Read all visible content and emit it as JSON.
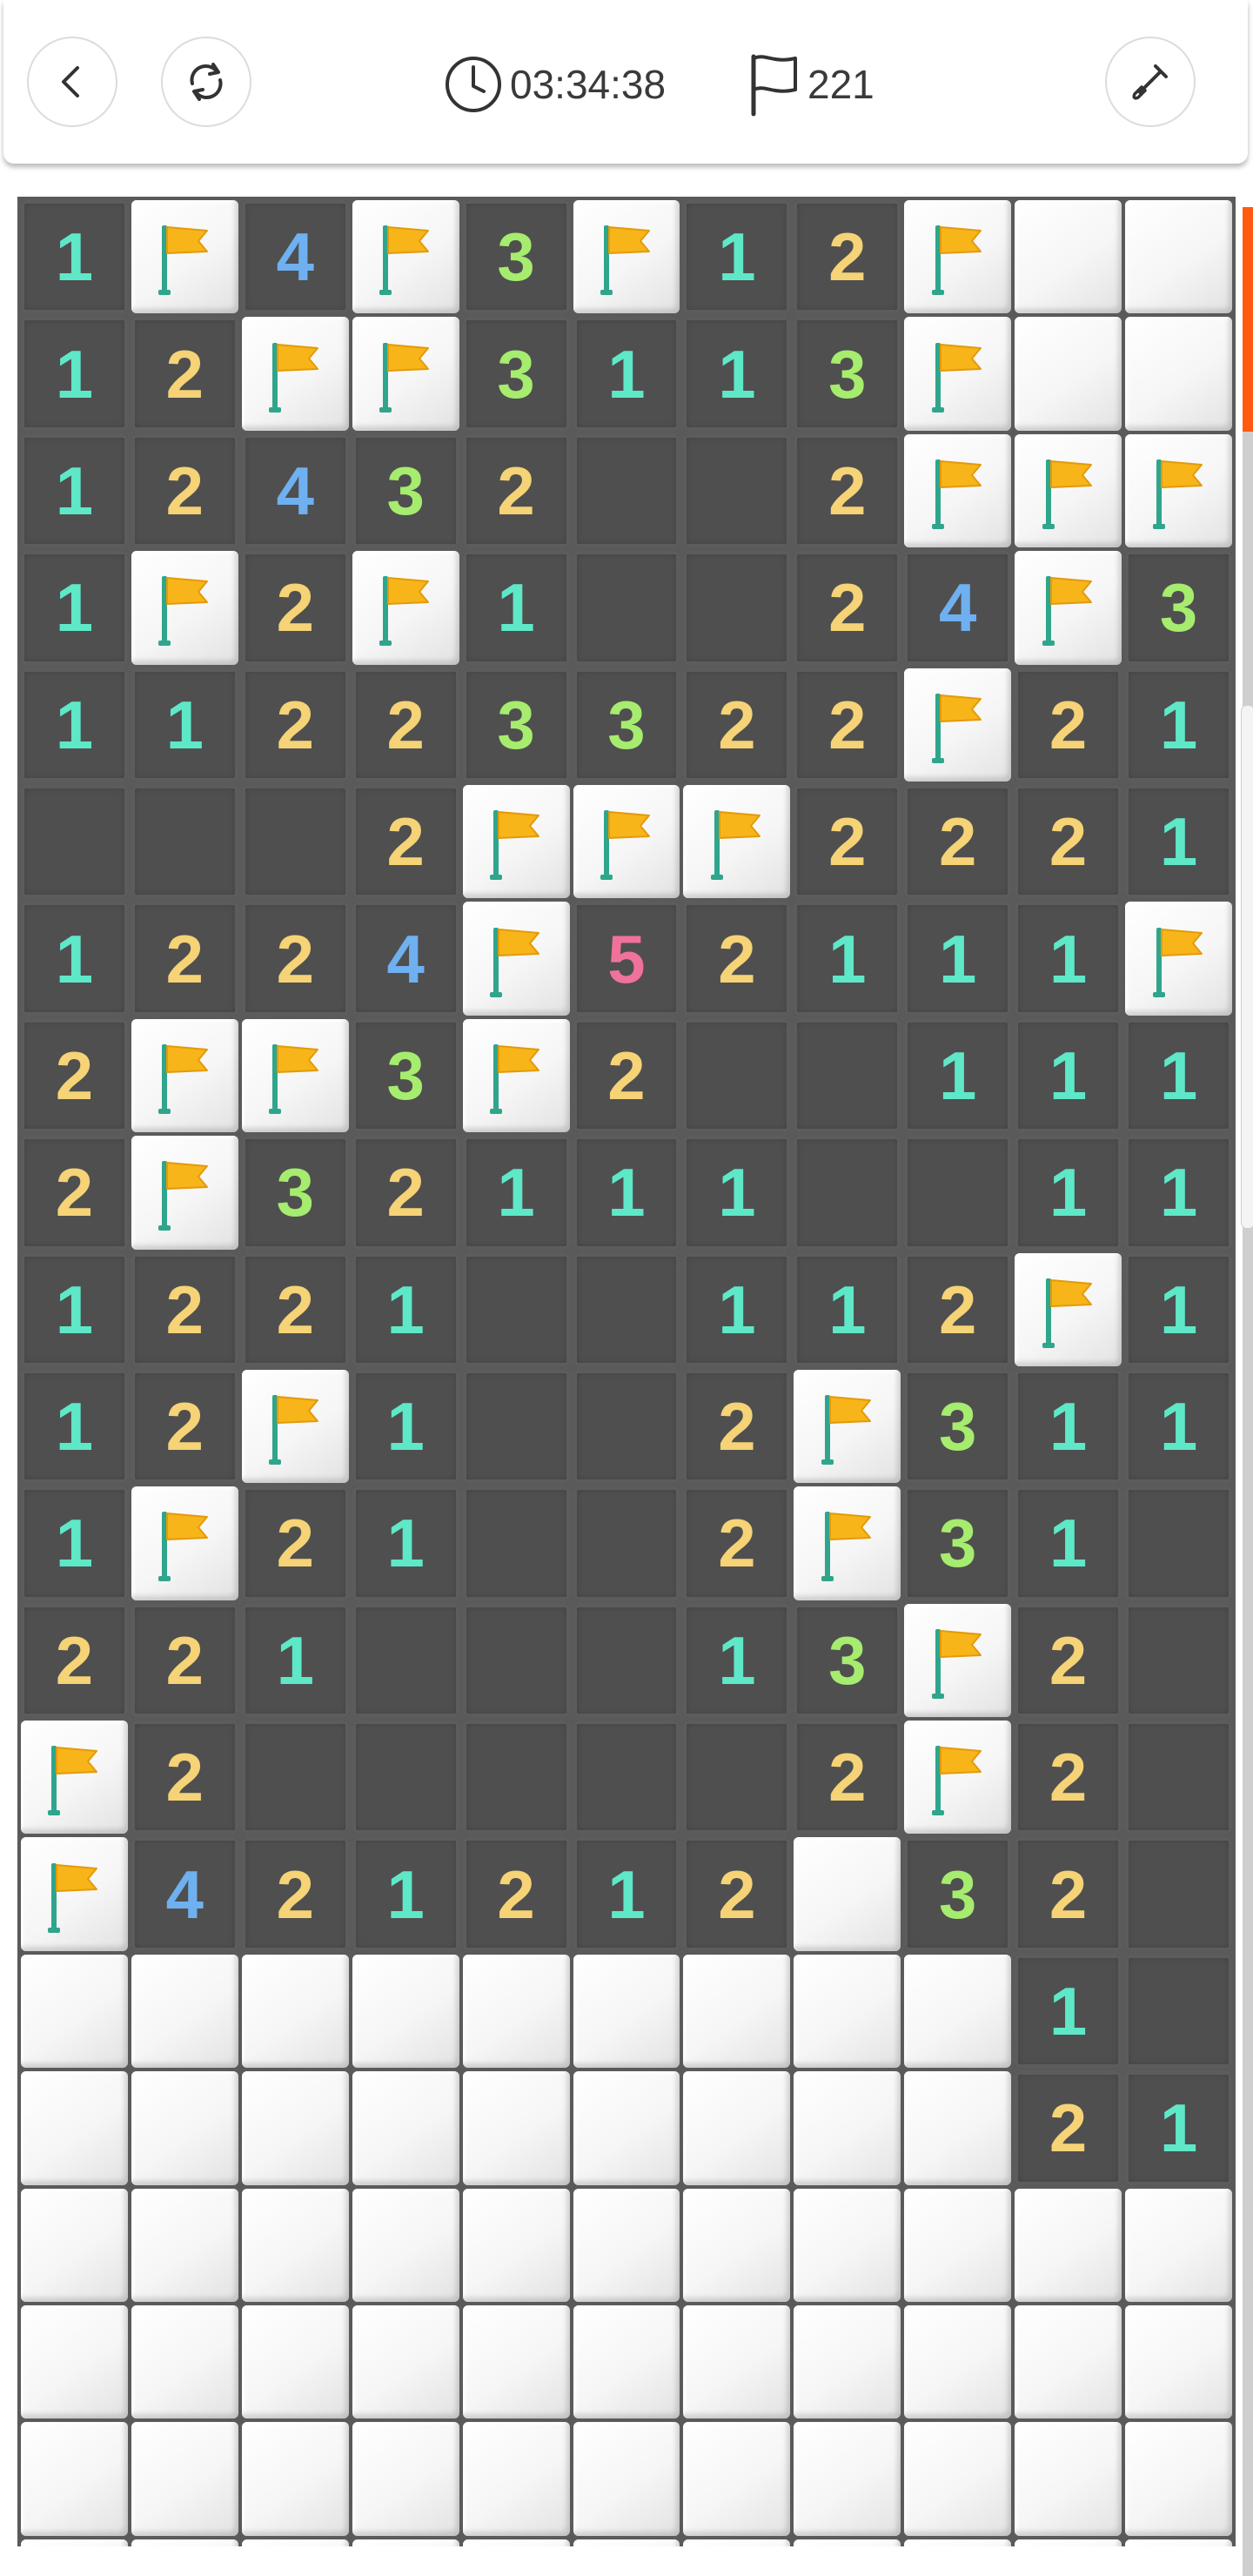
{
  "header": {
    "back_icon": "chevron-left-icon",
    "restart_icon": "refresh-icon",
    "timer_icon": "clock-icon",
    "timer": "03:34:38",
    "flags_icon": "flag-icon",
    "flag_count": "221",
    "tool_icon": "shovel-icon"
  },
  "colors": {
    "1": "#5ee8c8",
    "2": "#f5d376",
    "3": "#a6ec6e",
    "4": "#6fb0f0",
    "5": "#f0729a",
    "flag": "#f7b51a",
    "pole": "#2fa58c",
    "accent": "#ff5a10"
  },
  "board": {
    "columns": 11,
    "legend": "digit = revealed number, . = revealed empty, F = flag, # = covered",
    "rows": [
      "1F4F3F12F##",
      "12FF3113F##",
      "12432..2FFF",
      "1F2F1..24F3",
      "11223322F21",
      "...2FFF2221",
      "1224F52111F",
      "2FF3F2..111",
      "2F32111..111",
      "1221..112F1",
      "12F1..2F311",
      "1F21..2F31.",
      "221...13F2.",
      "F2.....2F2.",
      "F421212#32.",
      "#########1.",
      "#########21",
      "###########",
      "###########",
      "###########",
      "###########"
    ]
  }
}
